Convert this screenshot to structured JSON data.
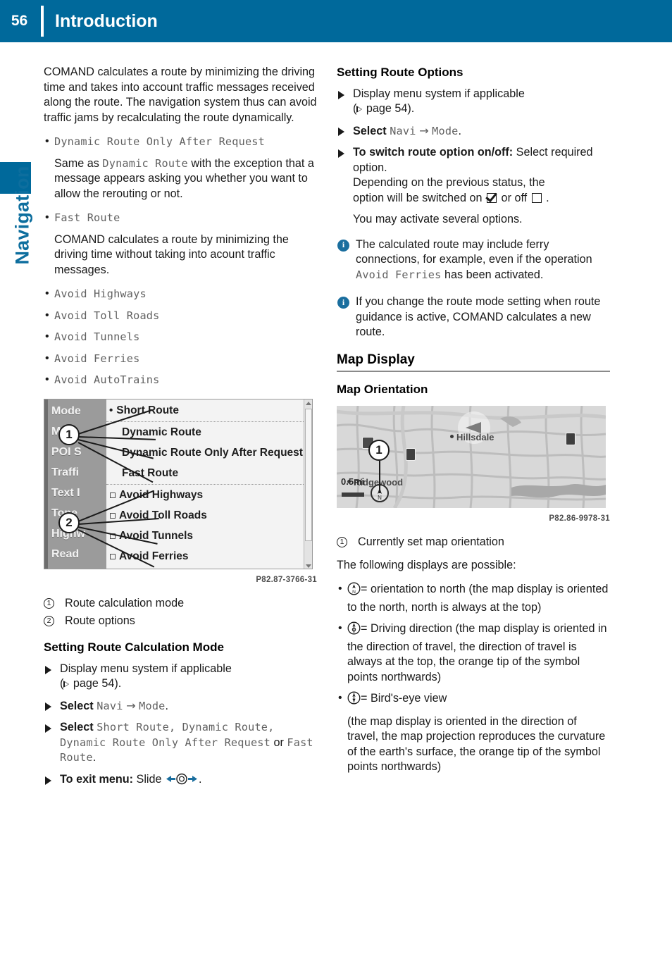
{
  "header": {
    "page_number": "56",
    "title": "Introduction",
    "accent_color": "#00699b"
  },
  "side_tab": {
    "label": "Navigation",
    "color": "#0d6e9e"
  },
  "left_column": {
    "intro_paragraph": "COMAND calculates a route by minimizing the driving time and takes into account traffic messages received along the route. The navigation system thus can avoid traffic jams by recalculating the route dynamically.",
    "options": [
      {
        "term": "Dynamic Route Only After Request",
        "desc_before": "Same as ",
        "desc_mono": "Dynamic Route",
        "desc_after": " with the exception that a message appears asking you whether you want to allow the rerouting or not."
      },
      {
        "term": "Fast Route",
        "desc_before": "COMAND calculates a route by minimizing the driving time without taking into acount traffic messages.",
        "desc_mono": "",
        "desc_after": ""
      }
    ],
    "plain_options": [
      "Avoid Highways",
      "Avoid Toll Roads",
      "Avoid Tunnels",
      "Avoid Ferries",
      "Avoid AutoTrains"
    ],
    "screenshot": {
      "side_menu": [
        "Mode",
        "Map ",
        "POI S",
        "Traffi",
        "Text I",
        "Tone",
        "Highw",
        "Read"
      ],
      "list_items": [
        {
          "label": "Short Route",
          "marker": "dot"
        },
        {
          "label": "Dynamic Route",
          "marker": "none"
        },
        {
          "label": "Dynamic Route Only After Request",
          "marker": "none"
        },
        {
          "label": "Fast Route",
          "marker": "none"
        },
        {
          "label": "Avoid Highways",
          "marker": "box"
        },
        {
          "label": "Avoid Toll Roads",
          "marker": "box"
        },
        {
          "label": "Avoid Tunnels",
          "marker": "box"
        },
        {
          "label": "Avoid Ferries",
          "marker": "box"
        }
      ],
      "callout_1": "1",
      "callout_2": "2",
      "image_ref": "P82.87-3766-31"
    },
    "callouts": [
      {
        "num": "1",
        "text": "Route calculation mode"
      },
      {
        "num": "2",
        "text": "Route options"
      }
    ],
    "heading": "Setting Route Calculation Mode",
    "steps": [
      {
        "kind": "pageref",
        "text_before": "Display menu system if applicable",
        "ref_text": "page 54"
      },
      {
        "kind": "select_path",
        "label": "Select ",
        "path_a": "Navi",
        "arrow": "→",
        "path_b": "Mode",
        "tail": "."
      },
      {
        "kind": "select_modes",
        "label": "Select ",
        "modes": "Short Route, Dynamic Route, Dynamic Route Only After Request",
        "tail_plain": " or ",
        "modes2": "Fast Route",
        "end": "."
      },
      {
        "kind": "exit",
        "bold": "To exit menu:",
        "text": " Slide",
        "end": "."
      }
    ]
  },
  "right_column": {
    "heading_options": "Setting Route Options",
    "steps": [
      {
        "kind": "pageref",
        "text_before": "Display menu system if applicable",
        "ref_text": "page 54"
      },
      {
        "kind": "select_path",
        "label": "Select ",
        "path_a": "Navi",
        "arrow": "→",
        "path_b": "Mode",
        "tail": "."
      },
      {
        "kind": "toggle",
        "bold": "To switch route option on/off:",
        "text": " Select required option.",
        "line2": "Depending on the previous status, the",
        "line3_before": "option will be switched on ",
        "line3_mid": " or off ",
        "line3_after": " ."
      }
    ],
    "after_steps": "You may activate several options.",
    "notes": [
      {
        "before": "The calculated route may include ferry connections, for example, even if the operation ",
        "mono": "Avoid Ferries",
        "after": " has been activated."
      },
      {
        "before": "If you change the route mode setting when route guidance is active, COMAND calculates a new route.",
        "mono": "",
        "after": ""
      }
    ],
    "section_heading": "Map Display",
    "sub_heading": "Map Orientation",
    "map": {
      "labels": [
        {
          "text": "Hillsdale"
        },
        {
          "text": "Ridgewood"
        }
      ],
      "scale": "0.5mi",
      "callout": "1",
      "image_ref": "P82.86-9978-31"
    },
    "map_callout": {
      "num": "1",
      "text": "Currently set map orientation"
    },
    "displays_intro": "The following displays are possible:",
    "display_modes": [
      {
        "icon": "compass-north-icon",
        "text": "= orientation to north (the map display is oriented to the north, north is always at the top)"
      },
      {
        "icon": "compass-heading-icon",
        "text": "= Driving direction (the map display is oriented in the direction of travel, the direction of travel is always at the top, the orange tip of the symbol points northwards)"
      },
      {
        "icon": "compass-birdseye-icon",
        "text": "= Bird's-eye view"
      }
    ],
    "birdseye_detail": "(the map display is oriented in the direction of travel, the map projection reproduces the curvature of the earth's surface, the orange tip of the symbol points northwards)"
  }
}
